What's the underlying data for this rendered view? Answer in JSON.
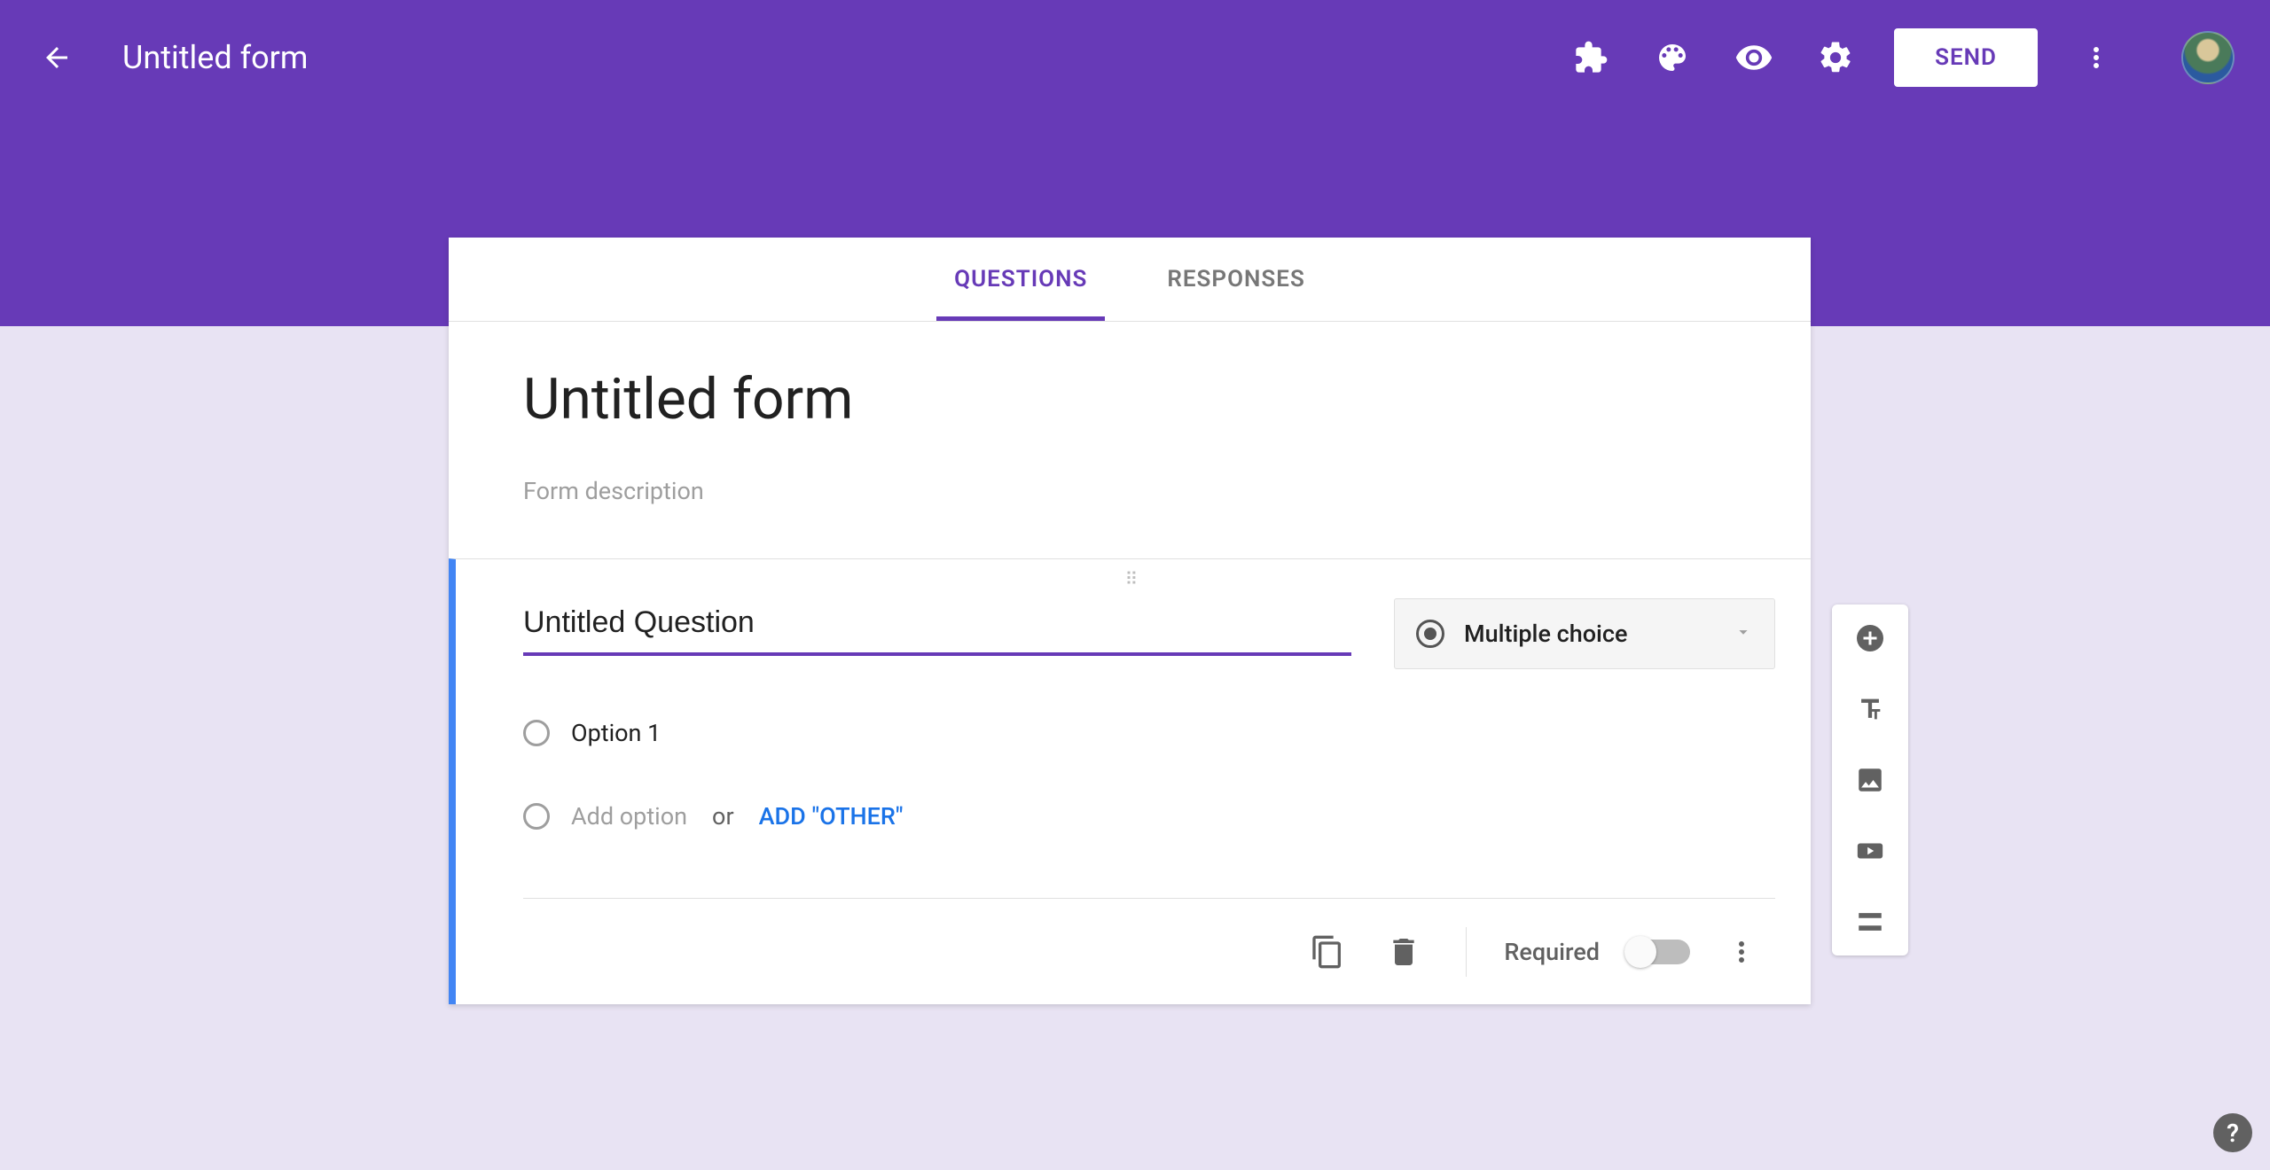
{
  "colors": {
    "primary": "#673ab7",
    "accent": "#4285f4",
    "link": "#1a73e8"
  },
  "header": {
    "doc_title": "Untitled form",
    "send_label": "SEND"
  },
  "tabs": {
    "questions": "QUESTIONS",
    "responses": "RESPONSES"
  },
  "form": {
    "title": "Untitled form",
    "description_placeholder": "Form description"
  },
  "question": {
    "title": "Untitled Question",
    "type_label": "Multiple choice",
    "options": [
      "Option 1"
    ],
    "add_option_placeholder": "Add option",
    "or_text": "or",
    "add_other_label": "ADD \"OTHER\"",
    "required_label": "Required",
    "required": false
  },
  "side_toolbar": {
    "items": [
      "add-question",
      "add-title",
      "add-image",
      "add-video",
      "add-section"
    ]
  }
}
